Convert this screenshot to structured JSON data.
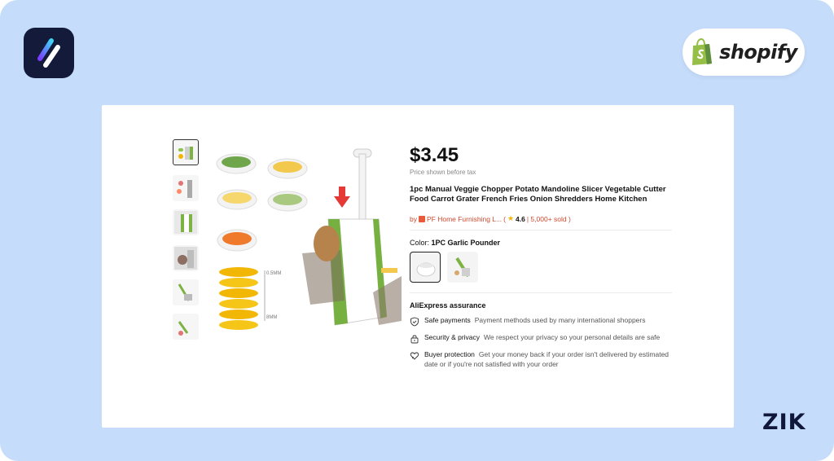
{
  "brand": {
    "shopify_label": "shopify",
    "corner_mark": "ZIK"
  },
  "product": {
    "price": "$3.45",
    "price_note": "Price shown before tax",
    "title": "1pc Manual Veggie Chopper Potato Mandoline Slicer Vegetable Cutter Food Carrot Grater French Fries Onion Shredders Home Kitchen",
    "seller_prefix": "by",
    "seller_name": "PF Home Furnishing L...",
    "rating_open": "( ",
    "rating": "4.6",
    "sold": " | 5,000+ sold )",
    "color_label": "Color: ",
    "color_value": "1PC Garlic Pounder",
    "image_labels": {
      "top": "0.5MM",
      "bottom": "8MM"
    }
  },
  "assurance": {
    "title": "AliExpress assurance",
    "items": [
      {
        "label": "Safe payments",
        "text": "Payment methods used by many international shoppers"
      },
      {
        "label": "Security & privacy",
        "text": "We respect your privacy so your personal details are safe"
      },
      {
        "label": "Buyer protection",
        "text": "Get your money back if your order isn't delivered by estimated date or if you're not satisfied with your order"
      }
    ]
  },
  "colors": {
    "accent": "#cc4a2f",
    "page_bg": "#c5dcfa",
    "shopify_green": "#95bf47"
  }
}
